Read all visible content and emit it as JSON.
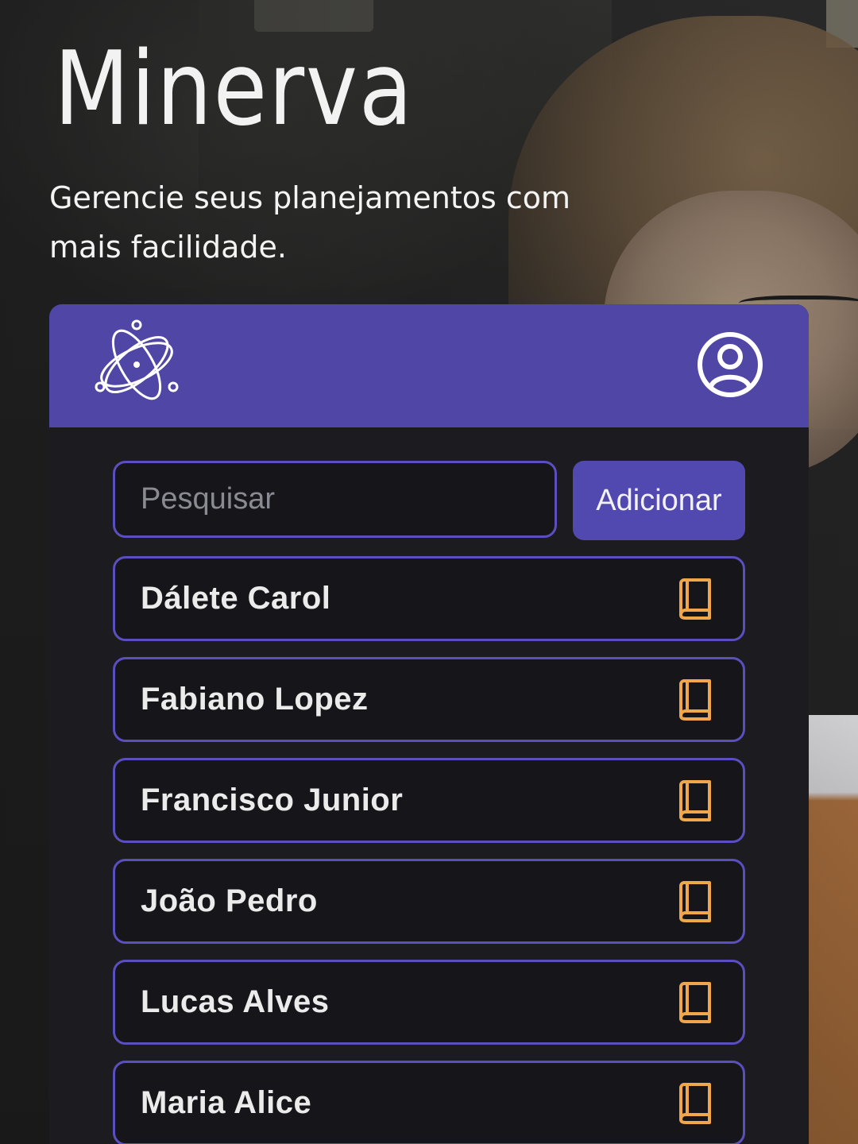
{
  "app": {
    "title": "Minerva",
    "subtitle": "Gerencie seus planejamentos com mais facilidade."
  },
  "header": {
    "logo_icon": "atom-icon",
    "profile_icon": "user-circle-icon"
  },
  "search": {
    "placeholder": "Pesquisar",
    "value": ""
  },
  "actions": {
    "add_label": "Adicionar"
  },
  "students": [
    {
      "name": "Dálete Carol",
      "icon": "book-icon"
    },
    {
      "name": "Fabiano Lopez",
      "icon": "book-icon"
    },
    {
      "name": "Francisco Junior",
      "icon": "book-icon"
    },
    {
      "name": "João Pedro",
      "icon": "book-icon"
    },
    {
      "name": "Lucas Alves",
      "icon": "book-icon"
    },
    {
      "name": "Maria Alice",
      "icon": "book-icon"
    }
  ],
  "colors": {
    "accent": "#4f46a6",
    "border": "#5b4fc0",
    "icon": "#f0a64a",
    "card_bg": "#1c1b1f"
  }
}
